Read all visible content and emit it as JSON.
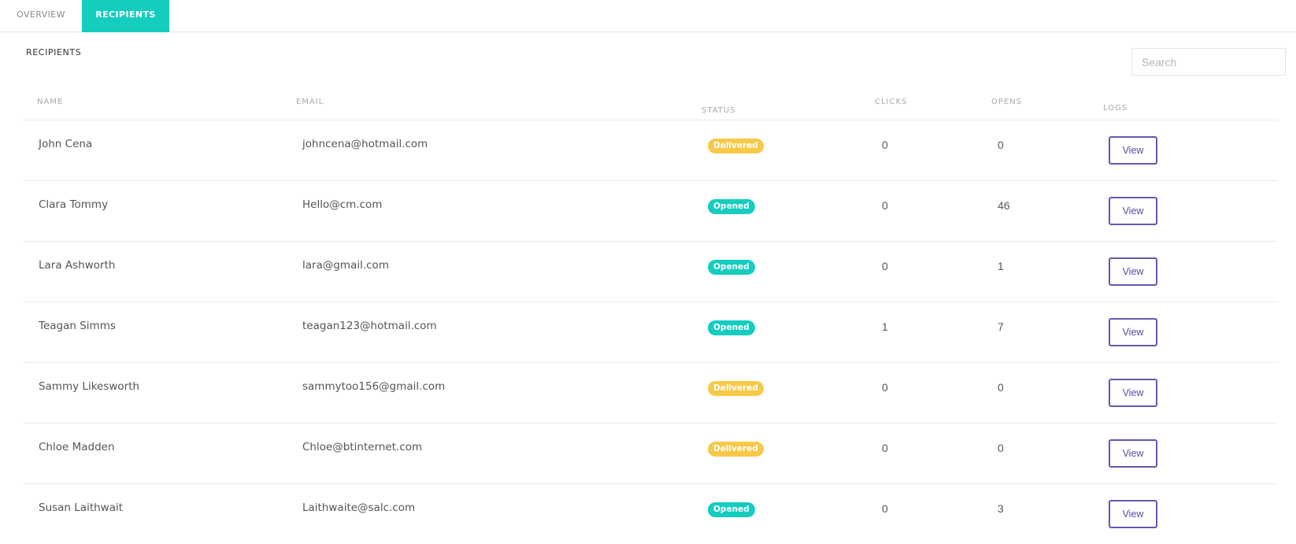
{
  "tabs": [
    {
      "label": "OVERVIEW",
      "active": false
    },
    {
      "label": "RECIPIENTS",
      "active": true
    }
  ],
  "section_title": "RECIPIENTS",
  "search": {
    "placeholder": "Search",
    "value": ""
  },
  "table": {
    "columns": [
      "NAME",
      "EMAIL",
      "STATUS",
      "CLICKS",
      "OPENS",
      "LOGS"
    ],
    "rows": [
      {
        "name": "John Cena",
        "email": "johncena@hotmail.com",
        "status": "Delivered",
        "clicks": "0",
        "opens": "0",
        "logs": "View"
      },
      {
        "name": "Clara Tommy",
        "email": "Hello@cm.com",
        "status": "Opened",
        "clicks": "0",
        "opens": "46",
        "logs": "View"
      },
      {
        "name": "Lara Ashworth",
        "email": "lara@gmail.com",
        "status": "Opened",
        "clicks": "0",
        "opens": "1",
        "logs": "View"
      },
      {
        "name": "Teagan Simms",
        "email": "teagan123@hotmail.com",
        "status": "Opened",
        "clicks": "1",
        "opens": "7",
        "logs": "View"
      },
      {
        "name": "Sammy Likesworth",
        "email": "sammytoo156@gmail.com",
        "status": "Delivered",
        "clicks": "0",
        "opens": "0",
        "logs": "View"
      },
      {
        "name": "Chloe Madden",
        "email": "Chloe@btinternet.com",
        "status": "Delivered",
        "clicks": "0",
        "opens": "0",
        "logs": "View"
      },
      {
        "name": "Susan Laithwait",
        "email": "Laithwaite@salc.com",
        "status": "Opened",
        "clicks": "0",
        "opens": "3",
        "logs": "View"
      }
    ]
  },
  "colors": {
    "accent": "#14cdbf",
    "delivered": "#f7c948",
    "opened": "#14cdbf",
    "button_border": "#6a55b0"
  }
}
